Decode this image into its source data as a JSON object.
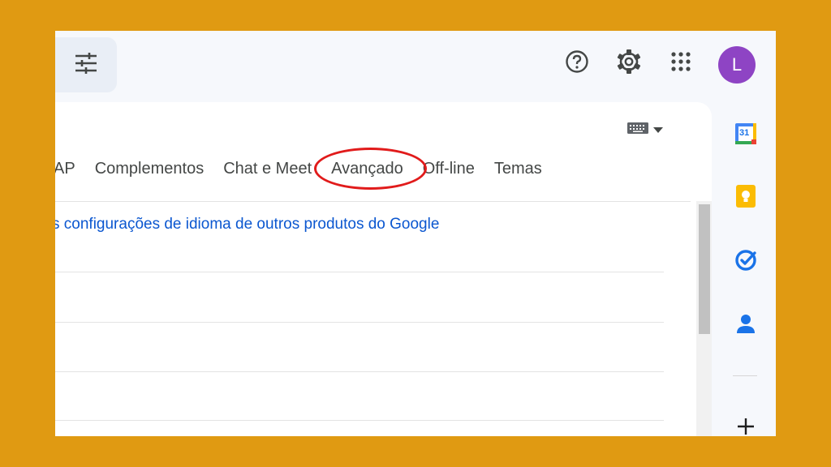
{
  "header": {
    "filter_icon": "tune-icon",
    "help_icon": "help-circle-icon",
    "settings_icon": "gear-icon",
    "apps_icon": "apps-grid-icon",
    "avatar_letter": "L",
    "avatar_color": "#8e44c4"
  },
  "settings": {
    "keyboard_icon": "keyboard-icon",
    "tabs": [
      {
        "label": "AP"
      },
      {
        "label": "Complementos"
      },
      {
        "label": "Chat e Meet"
      },
      {
        "label": "Avançado"
      },
      {
        "label": "Off-line"
      },
      {
        "label": "Temas"
      }
    ],
    "highlighted_tab": "Avançado",
    "highlight_color": "#e11b1b",
    "language_link": "s configurações de idioma de outros produtos do Google"
  },
  "side_panel": {
    "items": [
      {
        "icon": "calendar-icon",
        "label": "31"
      },
      {
        "icon": "keep-icon"
      },
      {
        "icon": "tasks-icon"
      },
      {
        "icon": "contacts-icon"
      }
    ],
    "add_icon": "plus-icon"
  },
  "colors": {
    "frame": "#e09a12",
    "link": "#0b57d0",
    "accent_blue": "#1a73e8",
    "keep_yellow": "#fbbc04"
  }
}
